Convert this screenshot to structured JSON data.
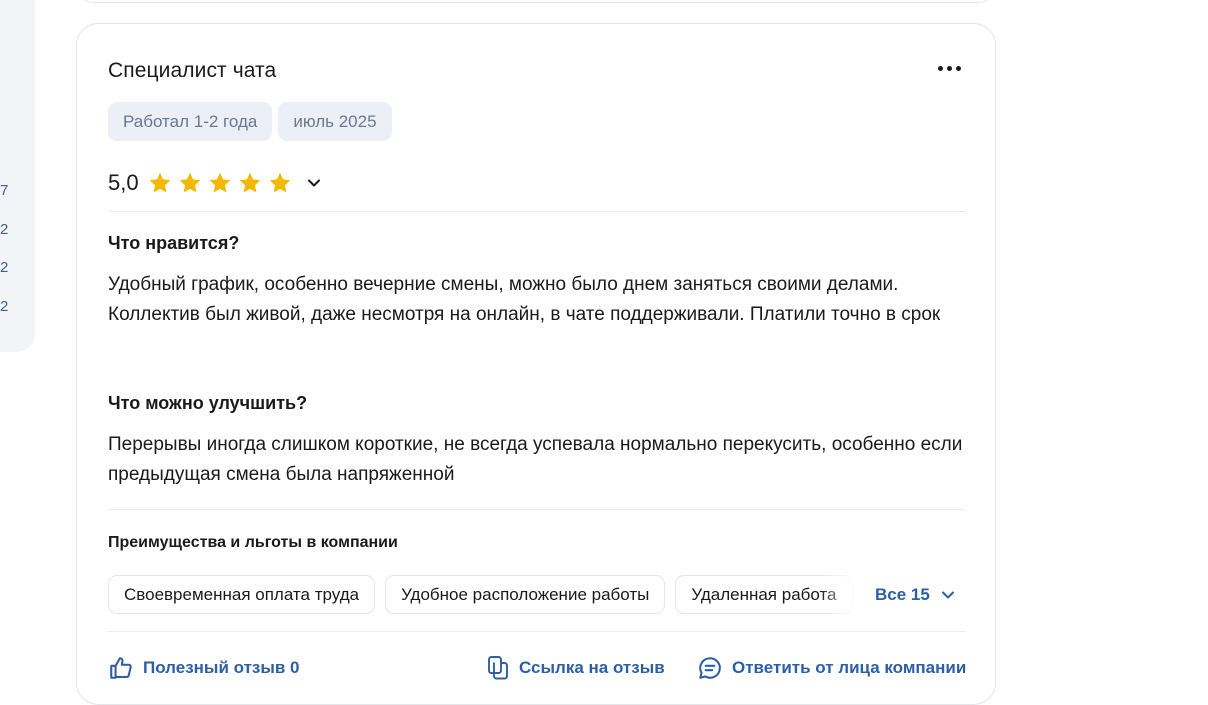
{
  "left_panel": {
    "numbers": [
      "7",
      "2",
      "2",
      "2"
    ]
  },
  "review": {
    "title": "Специалист чата",
    "tags": [
      "Работал 1-2 года",
      "июль 2025"
    ],
    "rating": {
      "value": "5,0",
      "stars": 5,
      "max_stars": 5,
      "star_color": "#f5b800"
    },
    "pros": {
      "title": "Что нравится?",
      "text": "Удобный график, особенно вечерние смены, можно было днем заняться своими делами. Коллектив был живой, даже несмотря на онлайн, в чате поддерживали. Платили точно в срок"
    },
    "cons": {
      "title": "Что можно улучшить?",
      "text": "Перерывы иногда слишком короткие, не всегда успевала нормально перекусить, особенно если предыдущая смена была напряженной"
    },
    "benefits": {
      "title": "Преимущества и льготы в компании",
      "chips": [
        "Своевременная оплата труда",
        "Удобное расположение работы",
        "Удаленная работа"
      ],
      "all_label": "Все 15"
    },
    "actions": {
      "helpful": "Полезный отзыв 0",
      "link": "Ссылка на отзыв",
      "reply": "Ответить от лица компании"
    }
  },
  "colors": {
    "accent": "#2d5ea8",
    "tag_bg": "#eceff5",
    "tag_text": "#6b7791"
  },
  "icons": [
    "more-icon",
    "star-icon",
    "chevron-down-icon",
    "thumbs-up-icon",
    "copy-link-icon",
    "chat-bubble-icon"
  ]
}
